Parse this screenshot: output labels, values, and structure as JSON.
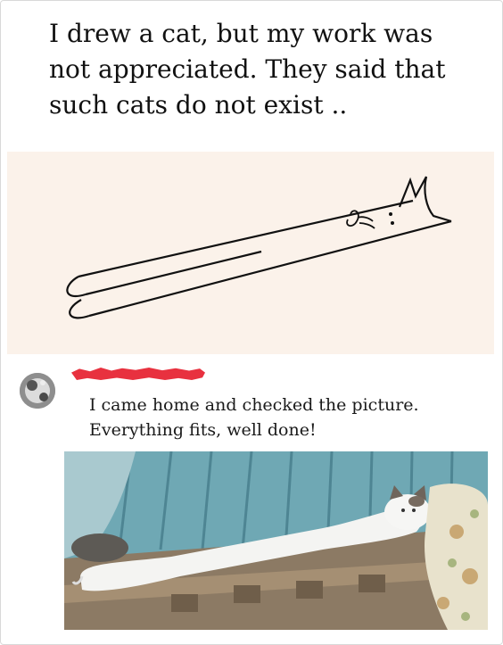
{
  "post": {
    "headline": "I drew a cat, but my work was not appreciated. They said that such cats do not exist .."
  },
  "comment": {
    "text": "I came home and checked the picture. Everything fits, well done!"
  }
}
